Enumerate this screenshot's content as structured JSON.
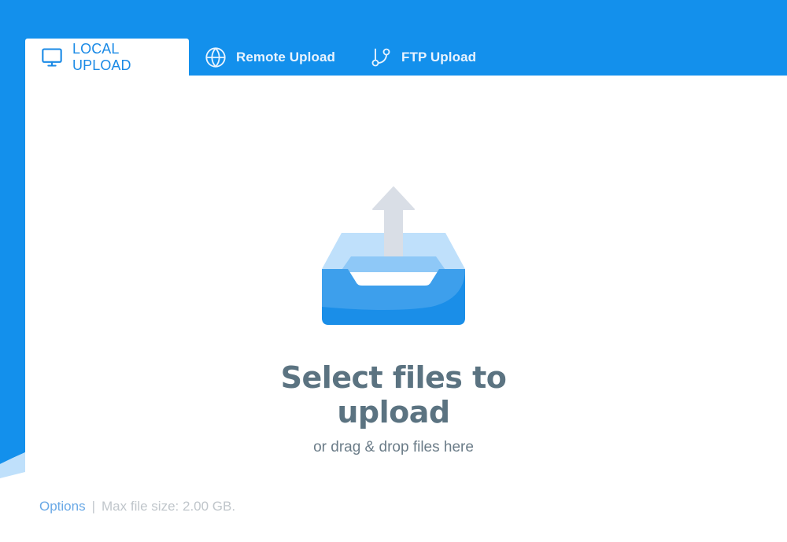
{
  "tabs": [
    {
      "label": "LOCAL UPLOAD",
      "icon": "monitor-icon",
      "active": true
    },
    {
      "label": "Remote Upload",
      "icon": "globe-icon",
      "active": false
    },
    {
      "label": "FTP Upload",
      "icon": "git-branch-icon",
      "active": false
    }
  ],
  "dropzone": {
    "title": "Select files to upload",
    "subtitle": "or drag & drop files here",
    "icon": "upload-tray-icon"
  },
  "footer": {
    "options_label": "Options",
    "separator": "|",
    "max_size_text": "Max file size: 2.00 GB."
  },
  "colors": {
    "brand_blue": "#1390ec",
    "tab_active_text": "#1a8ae6",
    "title_text": "#5b7381"
  }
}
